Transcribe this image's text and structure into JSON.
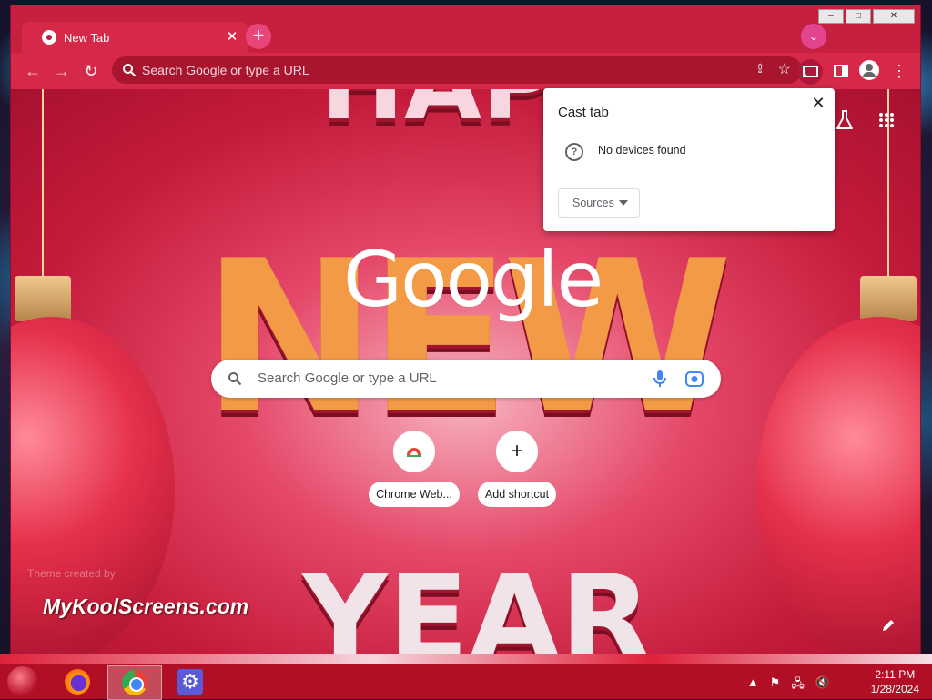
{
  "window": {
    "minimize": "–",
    "maximize": "□",
    "close": "✕"
  },
  "tab": {
    "title": "New Tab",
    "close": "✕"
  },
  "toolbar": {
    "back": "←",
    "forward": "→",
    "reload": "↻",
    "omnibox_placeholder": "Search Google or type a URL",
    "menu": "⋮"
  },
  "ntp": {
    "logo_text": "Google",
    "search_placeholder": "Search Google or type a URL",
    "shortcuts": [
      {
        "label": "Chrome Web..."
      },
      {
        "label": "Add shortcut",
        "glyph": "+"
      }
    ],
    "theme_credit": "Theme created by",
    "brand_text": "MyKoolScreens.com"
  },
  "cast_panel": {
    "title": "Cast tab",
    "close": "✕",
    "status": "No devices found",
    "sources_label": "Sources"
  },
  "taskbar": {
    "apps": [
      "Firefox",
      "Google Chrome",
      "Settings"
    ],
    "time": "2:11 PM",
    "date": "1/28/2024"
  },
  "colors": {
    "theme_red": "#c41b3b",
    "accent_pink": "#e8457b"
  }
}
